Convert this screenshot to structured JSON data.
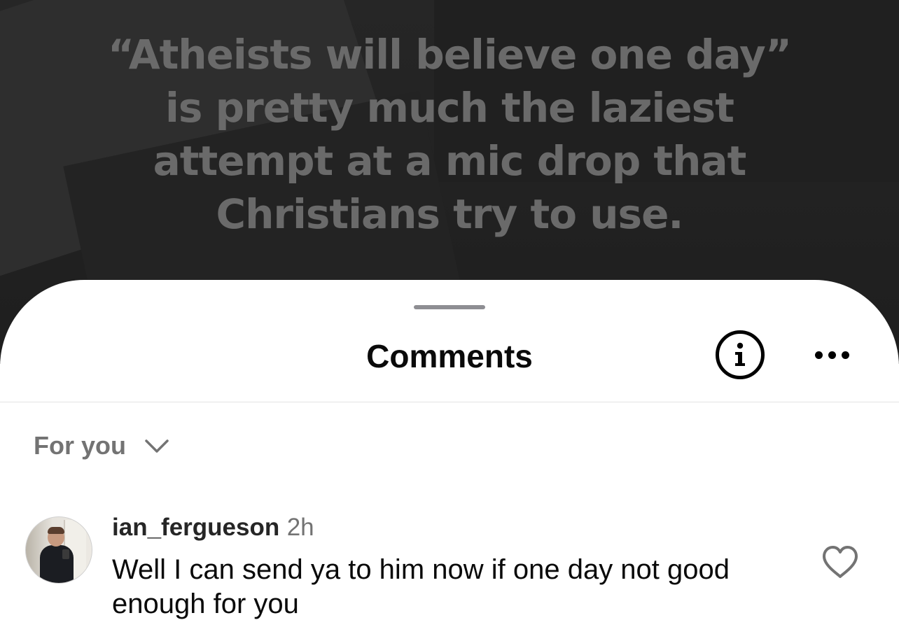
{
  "post": {
    "quote_lines": [
      "“Atheists will believe one day”",
      "is pretty much the laziest",
      "attempt at a mic drop that",
      "Christians try to use."
    ]
  },
  "sheet": {
    "title": "Comments",
    "info_icon": "info-icon",
    "more_icon": "more-horizontal-icon"
  },
  "sort": {
    "selected": "For you",
    "icon": "chevron-down-icon"
  },
  "comments": [
    {
      "username": "ian_fergueson",
      "time": "2h",
      "text": "Well I can send ya to him now if one day not good enough for you",
      "like_icon": "heart-icon"
    }
  ]
}
